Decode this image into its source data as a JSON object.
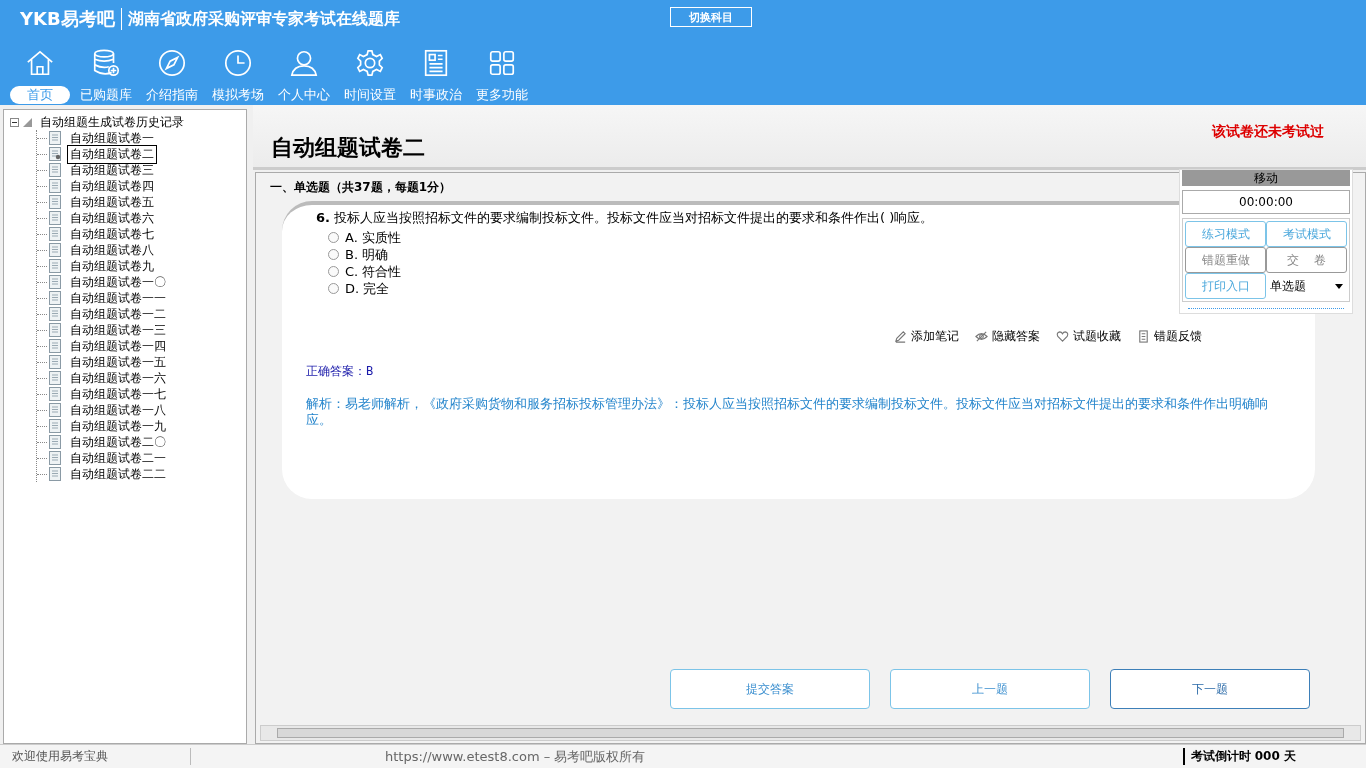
{
  "header": {
    "logo": "YKB易考吧",
    "title": "湖南省政府采购评审专家考试在线题库",
    "switch_button": "切换科目",
    "nav": [
      {
        "label": "首页",
        "kind": "home",
        "selected": true
      },
      {
        "label": "已购题库",
        "kind": "database",
        "selected": false
      },
      {
        "label": "介绍指南",
        "kind": "compass",
        "selected": false
      },
      {
        "label": "模拟考场",
        "kind": "clock",
        "selected": false
      },
      {
        "label": "个人中心",
        "kind": "user",
        "selected": false
      },
      {
        "label": "时间设置",
        "kind": "gear",
        "selected": false
      },
      {
        "label": "时事政治",
        "kind": "news",
        "selected": false
      },
      {
        "label": "更多功能",
        "kind": "grid",
        "selected": false
      }
    ]
  },
  "tree": {
    "root": "自动组题生成试卷历史记录",
    "expanded": true,
    "children": [
      {
        "label": "自动组题试卷一",
        "selected": false
      },
      {
        "label": "自动组题试卷二",
        "selected": true
      },
      {
        "label": "自动组题试卷三",
        "selected": false
      },
      {
        "label": "自动组题试卷四",
        "selected": false
      },
      {
        "label": "自动组题试卷五",
        "selected": false
      },
      {
        "label": "自动组题试卷六",
        "selected": false
      },
      {
        "label": "自动组题试卷七",
        "selected": false
      },
      {
        "label": "自动组题试卷八",
        "selected": false
      },
      {
        "label": "自动组题试卷九",
        "selected": false
      },
      {
        "label": "自动组题试卷一〇",
        "selected": false
      },
      {
        "label": "自动组题试卷一一",
        "selected": false
      },
      {
        "label": "自动组题试卷一二",
        "selected": false
      },
      {
        "label": "自动组题试卷一三",
        "selected": false
      },
      {
        "label": "自动组题试卷一四",
        "selected": false
      },
      {
        "label": "自动组题试卷一五",
        "selected": false
      },
      {
        "label": "自动组题试卷一六",
        "selected": false
      },
      {
        "label": "自动组题试卷一七",
        "selected": false
      },
      {
        "label": "自动组题试卷一八",
        "selected": false
      },
      {
        "label": "自动组题试卷一九",
        "selected": false
      },
      {
        "label": "自动组题试卷二〇",
        "selected": false
      },
      {
        "label": "自动组题试卷二一",
        "selected": false
      },
      {
        "label": "自动组题试卷二二",
        "selected": false
      }
    ]
  },
  "paper": {
    "title": "自动组题试卷二",
    "status_note": "该试卷还未考试过",
    "section": "一、单选题（共37题，每题1分）",
    "question": {
      "number": "6.",
      "text": "投标人应当按照招标文件的要求编制投标文件。投标文件应当对招标文件提出的要求和条件作出(  )响应。",
      "options": [
        {
          "letter": "A.",
          "text": "实质性",
          "selected": false
        },
        {
          "letter": "B.",
          "text": "明确",
          "selected": false
        },
        {
          "letter": "C.",
          "text": "符合性",
          "selected": false
        },
        {
          "letter": "D.",
          "text": "完全",
          "selected": false
        }
      ]
    },
    "actions": [
      {
        "label": "添加笔记",
        "kind": "pencil"
      },
      {
        "label": "隐藏答案",
        "kind": "eye"
      },
      {
        "label": "试题收藏",
        "kind": "heart"
      },
      {
        "label": "错题反馈",
        "kind": "doc"
      }
    ],
    "answer_label": "正确答案：",
    "answer": "B",
    "explanation": "解析：易老师解析，《政府采购货物和服务招标投标管理办法》：投标人应当按照招标文件的要求编制投标文件。投标文件应当对招标文件提出的要求和条件作出明确响应。",
    "nav_buttons": [
      "提交答案",
      "上一题",
      "下一题"
    ]
  },
  "panel": {
    "title": "移动",
    "timer": "00:00:00",
    "buttons": [
      {
        "label": "练习模式",
        "kind": "blue"
      },
      {
        "label": "考试模式",
        "kind": "blue"
      },
      {
        "label": "错题重做",
        "kind": "gray"
      },
      {
        "label": "交    卷",
        "kind": "gray"
      },
      {
        "label": "打印入口",
        "kind": "blue"
      }
    ],
    "type_select": "单选题"
  },
  "status_bar": {
    "welcome": "欢迎使用易考宝典",
    "copyright": "https://www.etest8.com – 易考吧版权所有",
    "countdown": "考试倒计时 000 天"
  }
}
